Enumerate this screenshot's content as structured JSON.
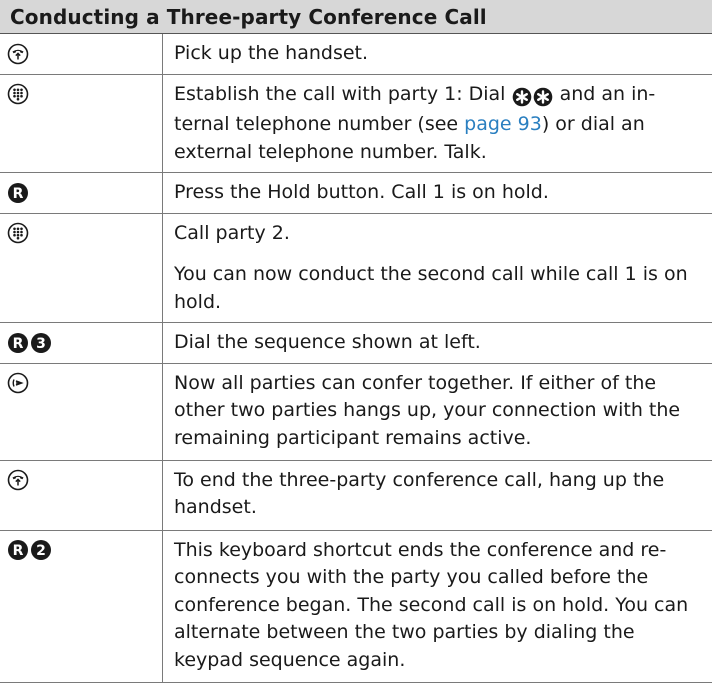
{
  "section_title": "Conducting a Three-party Conference Call",
  "rows": [
    {
      "icon": "handset-pickup-icon",
      "text": "Pick up the handset."
    },
    {
      "icon": "keypad-icon",
      "text_before": "Establish the call with party 1: Dial",
      "inline_keys": [
        "*",
        "*"
      ],
      "text_mid": "and an in- ternal telephone number (see",
      "link": "page 93",
      "text_after": ") or dial an external telephone number. Talk."
    },
    {
      "keys": [
        "R"
      ],
      "text": "Press the Hold button. Call 1 is on hold."
    },
    {
      "icon": "keypad-icon",
      "text": "Call party 2.",
      "note": "You can now conduct the second call while call 1 is on hold."
    },
    {
      "keys": [
        "R",
        "3"
      ],
      "text": "Dial the sequence shown at left."
    },
    {
      "icon": "conference-icon",
      "text": "Now all parties can confer together. If either of the other two parties hangs up, your connection with the remaining participant remains active."
    },
    {
      "icon": "handset-hangup-icon",
      "text": "To end the three-party conference call, hang up the handset."
    },
    {
      "keys": [
        "R",
        "2"
      ],
      "text": "This keyboard shortcut ends the conference and re- connects you with the party you called before the conference began. The second call is on hold. You can alternate between the two parties by dialing the keypad sequence again."
    }
  ]
}
